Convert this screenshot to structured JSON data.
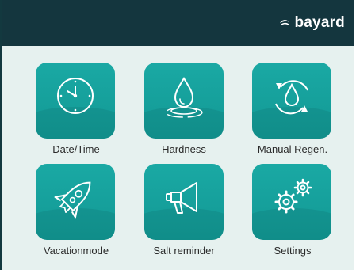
{
  "brand": {
    "name": "bayard"
  },
  "menu": [
    {
      "id": "date-time",
      "label": "Date/Time",
      "icon": "clock-icon"
    },
    {
      "id": "hardness",
      "label": "Hardness",
      "icon": "water-drop-icon"
    },
    {
      "id": "manual-regen",
      "label": "Manual Regen.",
      "icon": "regeneration-icon"
    },
    {
      "id": "vacation-mode",
      "label": "Vacationmode",
      "icon": "rocket-icon"
    },
    {
      "id": "salt-reminder",
      "label": "Salt reminder",
      "icon": "megaphone-icon"
    },
    {
      "id": "settings",
      "label": "Settings",
      "icon": "gears-icon"
    }
  ],
  "colors": {
    "header": "#14363e",
    "background": "#e6f1ef",
    "tile": "#1aa9a4"
  }
}
